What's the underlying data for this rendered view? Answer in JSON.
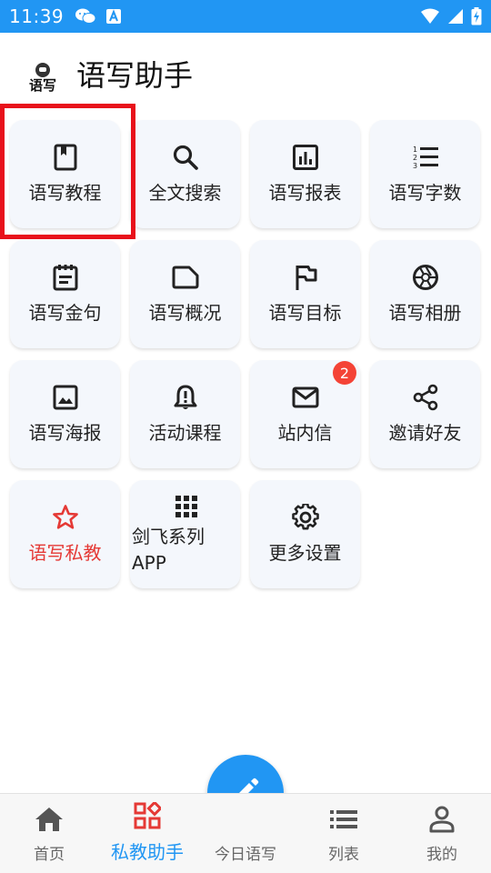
{
  "status_bar": {
    "time": "11:39",
    "left_icons": [
      "wechat-icon",
      "translate-icon"
    ],
    "right_icons": [
      "wifi-icon",
      "signal-icon",
      "battery-charging-icon"
    ]
  },
  "header": {
    "logo_text": "语写",
    "title": "语写助手"
  },
  "tiles": [
    {
      "label": "语写教程",
      "icon": "book-icon"
    },
    {
      "label": "全文搜索",
      "icon": "search-icon"
    },
    {
      "label": "语写报表",
      "icon": "bar-chart-icon"
    },
    {
      "label": "语写字数",
      "icon": "numbered-list-icon"
    },
    {
      "label": "语写金句",
      "icon": "notepad-icon"
    },
    {
      "label": "语写概况",
      "icon": "folder-icon"
    },
    {
      "label": "语写目标",
      "icon": "flag-icon"
    },
    {
      "label": "语写相册",
      "icon": "camera-shutter-icon"
    },
    {
      "label": "语写海报",
      "icon": "image-icon"
    },
    {
      "label": "活动课程",
      "icon": "alert-bell-icon"
    },
    {
      "label": "站内信",
      "icon": "mail-icon",
      "badge": "2"
    },
    {
      "label": "邀请好友",
      "icon": "share-icon"
    },
    {
      "label": "语写私教",
      "icon": "star-icon",
      "accent_color": "#e53935"
    },
    {
      "label": "剑飞系列APP",
      "icon": "apps-grid-icon"
    },
    {
      "label": "更多设置",
      "icon": "gear-icon"
    }
  ],
  "bottom_nav": {
    "items": [
      {
        "label": "首页",
        "icon": "home-icon"
      },
      {
        "label": "私教助手",
        "icon": "widgets-icon",
        "active": true
      },
      {
        "label": "今日语写",
        "icon": "edit-icon"
      },
      {
        "label": "列表",
        "icon": "list-icon"
      },
      {
        "label": "我的",
        "icon": "person-icon"
      }
    ]
  },
  "colors": {
    "primary": "#2196f3",
    "accent_red": "#e53935",
    "badge": "#f44336",
    "highlight_border": "#e8111b",
    "tile_bg": "#f4f7fc"
  }
}
